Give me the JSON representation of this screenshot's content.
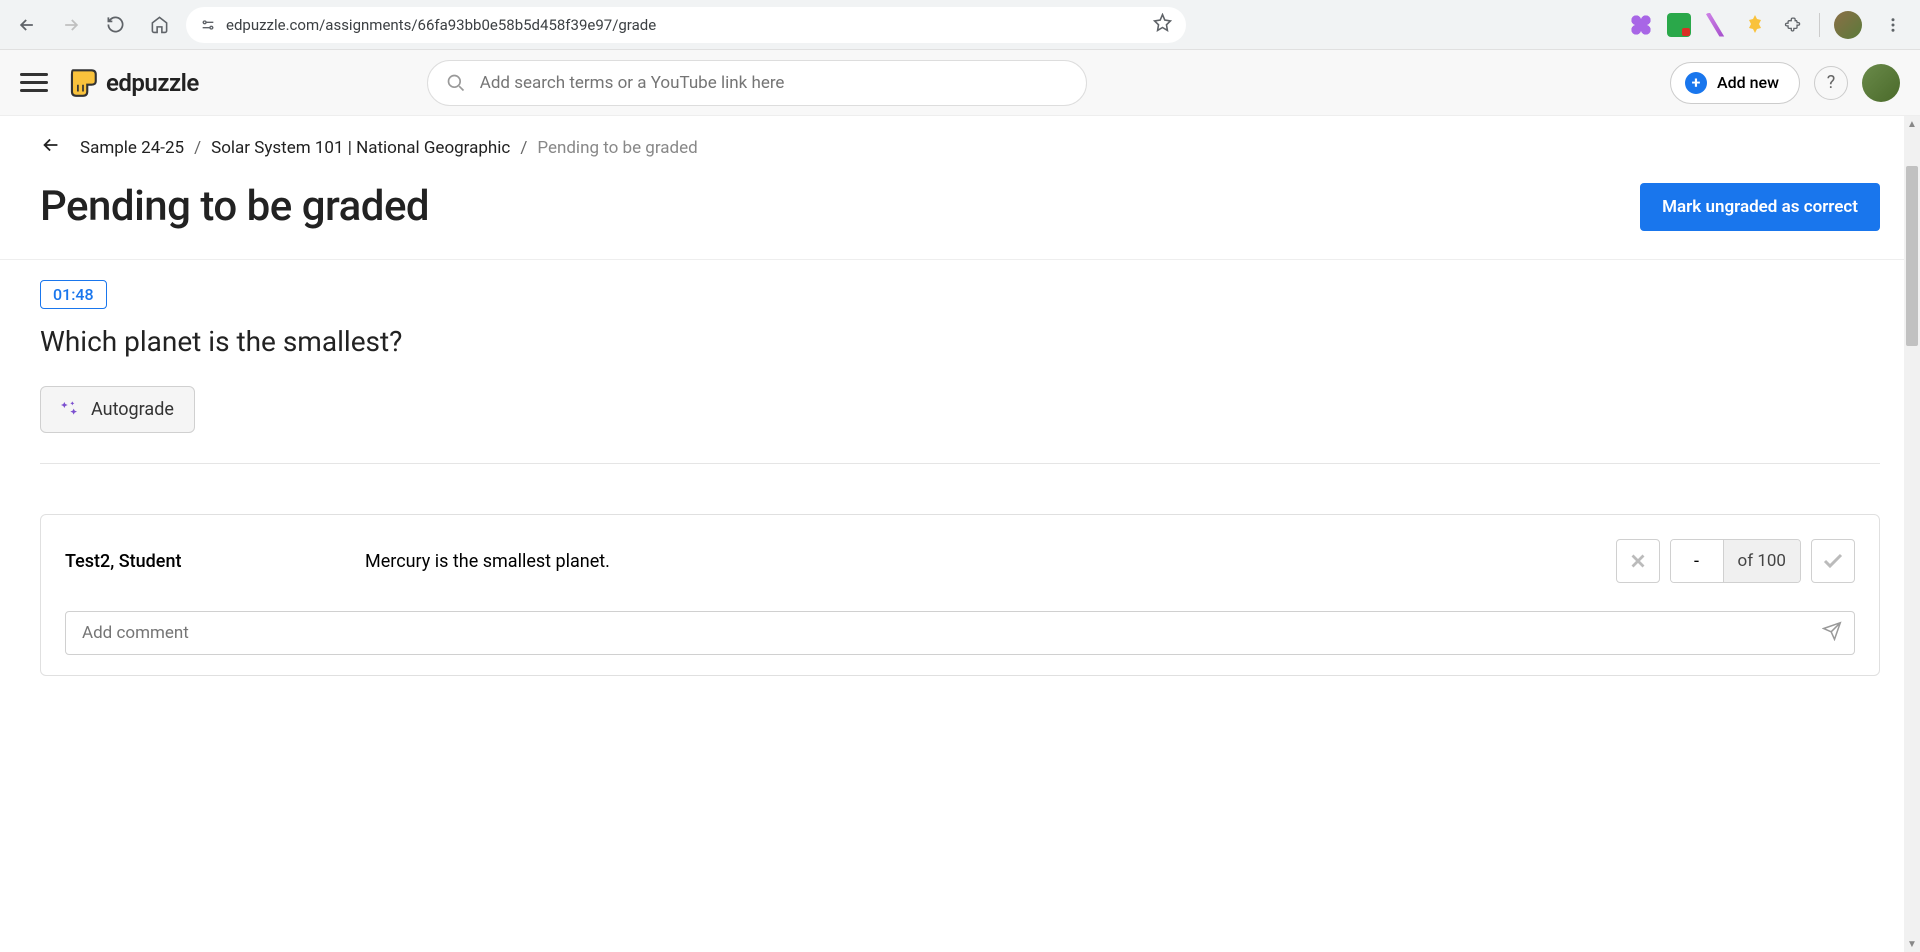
{
  "browser": {
    "url": "edpuzzle.com/assignments/66fa93bb0e58b5d458f39e97/grade"
  },
  "header": {
    "logo_text": "edpuzzle",
    "search_placeholder": "Add search terms or a YouTube link here",
    "add_new_label": "Add new"
  },
  "breadcrumb": {
    "level1": "Sample 24-25",
    "level2": "Solar System 101 | National Geographic",
    "current": "Pending to be graded"
  },
  "page": {
    "title": "Pending to be graded",
    "mark_correct_label": "Mark ungraded as correct"
  },
  "question": {
    "timestamp": "01:48",
    "text": "Which planet is the smallest?",
    "autograde_label": "Autograde"
  },
  "response": {
    "student": "Test2, Student",
    "answer": "Mercury is the smallest planet.",
    "score_value": "-",
    "score_max_label": "of 100",
    "comment_placeholder": "Add comment"
  }
}
